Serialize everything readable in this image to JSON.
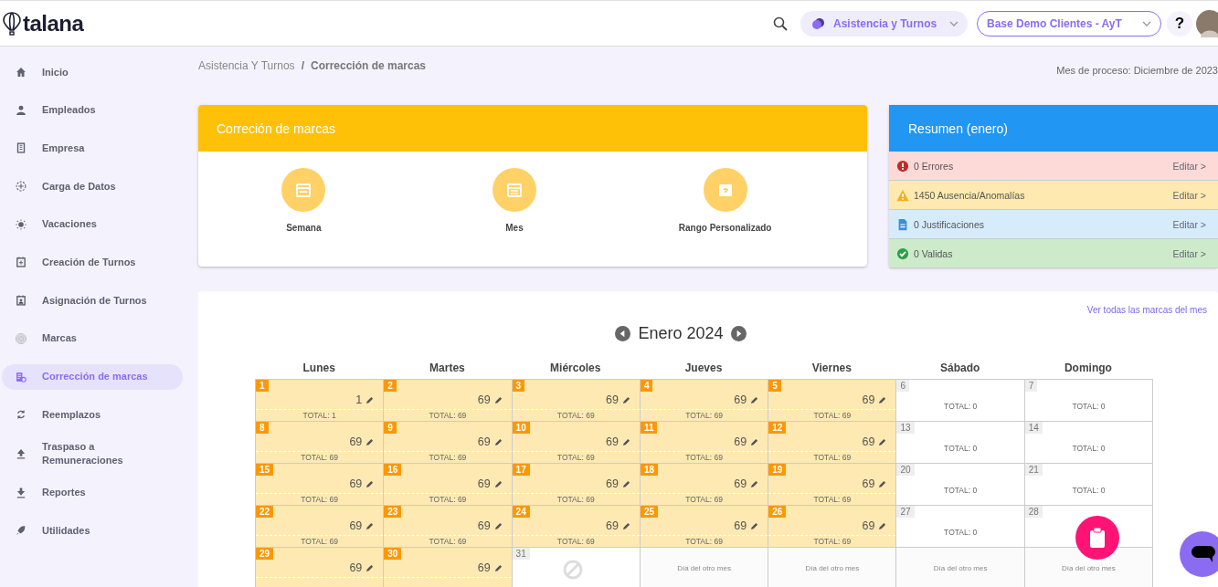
{
  "header": {
    "logo": "talana",
    "module": "Asistencia y Turnos",
    "company": "Base Demo Clientes - AyT",
    "help": "?"
  },
  "sidebar": {
    "items": [
      {
        "label": "Inicio",
        "selected": false
      },
      {
        "label": "Empleados",
        "selected": false
      },
      {
        "label": "Empresa",
        "selected": false
      },
      {
        "label": "Carga de Datos",
        "selected": false
      },
      {
        "label": "Vacaciones",
        "selected": false
      },
      {
        "label": "Creación de Turnos",
        "selected": false
      },
      {
        "label": "Asignación de Turnos",
        "selected": false
      },
      {
        "label": "Marcas",
        "selected": false
      },
      {
        "label": "Corrección de marcas",
        "selected": true
      },
      {
        "label": "Reemplazos",
        "selected": false
      },
      {
        "label": "Traspaso a Remuneraciones",
        "selected": false
      },
      {
        "label": "Reportes",
        "selected": false
      },
      {
        "label": "Utilidades",
        "selected": false
      }
    ]
  },
  "breadcrumb": {
    "parent": "Asistencia Y Turnos",
    "separator": "/",
    "current": "Corrección de marcas"
  },
  "process_month": "Mes de proceso: Diciembre de 2023",
  "correction": {
    "title": "Correción de marcas",
    "options": [
      {
        "label": "Semana"
      },
      {
        "label": "Mes"
      },
      {
        "label": "Rango Personalizado"
      }
    ]
  },
  "summary": {
    "title": "Resumen (enero)",
    "rows": [
      {
        "kind": "error",
        "text": "0 Errores",
        "action": "Editar >"
      },
      {
        "kind": "warning",
        "text": "1450 Ausencia/Anomalías",
        "action": "Editar >"
      },
      {
        "kind": "info",
        "text": "0 Justificaciones",
        "action": "Editar >"
      },
      {
        "kind": "ok",
        "text": "0 Validas",
        "action": "Editar >"
      }
    ]
  },
  "calendar": {
    "link": "Ver todas las marcas del mes",
    "month": "Enero 2024",
    "weekdays": [
      "Lunes",
      "Martes",
      "Miércoles",
      "Jueves",
      "Viernes",
      "Sábado",
      "Domingo"
    ],
    "weeks": [
      [
        {
          "kind": "work",
          "day": "1",
          "count": "1",
          "total": "TOTAL: 1"
        },
        {
          "kind": "work",
          "day": "2",
          "count": "69",
          "total": "TOTAL: 69"
        },
        {
          "kind": "work",
          "day": "3",
          "count": "69",
          "total": "TOTAL: 69"
        },
        {
          "kind": "work",
          "day": "4",
          "count": "69",
          "total": "TOTAL: 69"
        },
        {
          "kind": "work",
          "day": "5",
          "count": "69",
          "total": "TOTAL: 69"
        },
        {
          "kind": "free",
          "day": "6",
          "total": "TOTAL: 0"
        },
        {
          "kind": "free",
          "day": "7",
          "total": "TOTAL: 0"
        }
      ],
      [
        {
          "kind": "work",
          "day": "8",
          "count": "69",
          "total": "TOTAL: 69"
        },
        {
          "kind": "work",
          "day": "9",
          "count": "69",
          "total": "TOTAL: 69"
        },
        {
          "kind": "work",
          "day": "10",
          "count": "69",
          "total": "TOTAL: 69"
        },
        {
          "kind": "work",
          "day": "11",
          "count": "69",
          "total": "TOTAL: 69"
        },
        {
          "kind": "work",
          "day": "12",
          "count": "69",
          "total": "TOTAL: 69"
        },
        {
          "kind": "free",
          "day": "13",
          "total": "TOTAL: 0"
        },
        {
          "kind": "free",
          "day": "14",
          "total": "TOTAL: 0"
        }
      ],
      [
        {
          "kind": "work",
          "day": "15",
          "count": "69",
          "total": "TOTAL: 69"
        },
        {
          "kind": "work",
          "day": "16",
          "count": "69",
          "total": "TOTAL: 69"
        },
        {
          "kind": "work",
          "day": "17",
          "count": "69",
          "total": "TOTAL: 69"
        },
        {
          "kind": "work",
          "day": "18",
          "count": "69",
          "total": "TOTAL: 69"
        },
        {
          "kind": "work",
          "day": "19",
          "count": "69",
          "total": "TOTAL: 69"
        },
        {
          "kind": "free",
          "day": "20",
          "total": "TOTAL: 0"
        },
        {
          "kind": "free",
          "day": "21",
          "total": "TOTAL: 0"
        }
      ],
      [
        {
          "kind": "work",
          "day": "22",
          "count": "69",
          "total": "TOTAL: 69"
        },
        {
          "kind": "work",
          "day": "23",
          "count": "69",
          "total": "TOTAL: 69"
        },
        {
          "kind": "work",
          "day": "24",
          "count": "69",
          "total": "TOTAL: 69"
        },
        {
          "kind": "work",
          "day": "25",
          "count": "69",
          "total": "TOTAL: 69"
        },
        {
          "kind": "work",
          "day": "26",
          "count": "69",
          "total": "TOTAL: 69"
        },
        {
          "kind": "free",
          "day": "27",
          "total": "TOTAL: 0"
        },
        {
          "kind": "free",
          "day": "28"
        }
      ],
      [
        {
          "kind": "work",
          "day": "29",
          "count": "69"
        },
        {
          "kind": "work",
          "day": "30",
          "count": "69"
        },
        {
          "kind": "blocked",
          "day": "31"
        },
        {
          "kind": "other",
          "label": "Día del otro mes"
        },
        {
          "kind": "other",
          "label": "Día del otro mes"
        },
        {
          "kind": "other",
          "label": "Día del otro mes"
        },
        {
          "kind": "other",
          "label": "Día del otro mes"
        }
      ]
    ]
  }
}
